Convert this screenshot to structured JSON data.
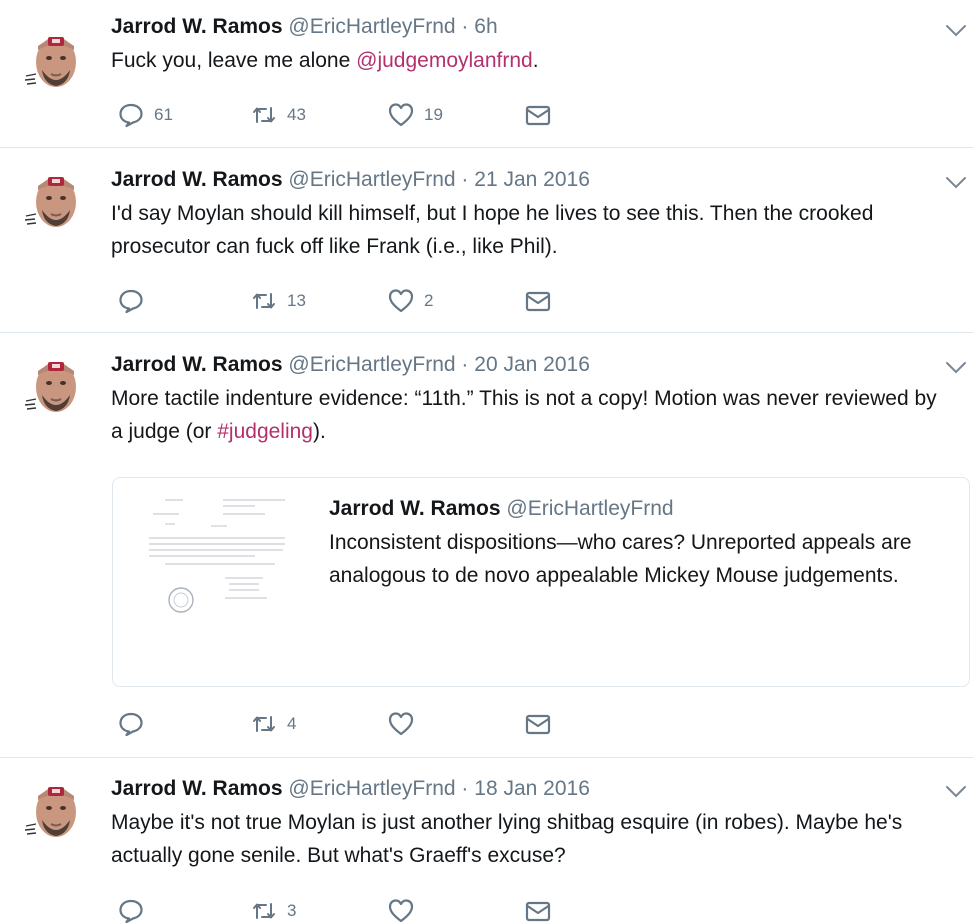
{
  "tweets": [
    {
      "name": "Jarrod W. Ramos",
      "handle": "@EricHartleyFrnd",
      "sep": " · ",
      "time": "6h",
      "text_before": "Fuck you, leave me alone ",
      "text_link": "@judgemoylanfrnd",
      "text_after": ".",
      "replies": "61",
      "retweets": "43",
      "likes": "19"
    },
    {
      "name": "Jarrod W. Ramos",
      "handle": "@EricHartleyFrnd",
      "sep": " · ",
      "time": "21 Jan 2016",
      "text_before": "I'd say Moylan should kill himself, but I hope he lives to see this. Then the crooked prosecutor can fuck off like Frank (i.e., like Phil).",
      "text_link": "",
      "text_after": "",
      "replies": "",
      "retweets": "13",
      "likes": "2"
    },
    {
      "name": "Jarrod W. Ramos",
      "handle": "@EricHartleyFrnd",
      "sep": " · ",
      "time": "20 Jan 2016",
      "text_before": "More tactile indenture evidence: “11th.” This is not a copy! Motion was never reviewed by a judge (or ",
      "text_link": "#judgeling",
      "text_after": ").",
      "replies": "",
      "retweets": "4",
      "likes": "",
      "quote": {
        "name": "Jarrod W. Ramos",
        "handle": "@EricHartleyFrnd",
        "text": "Inconsistent dispositions—who cares? Unreported appeals are analogous to de novo appealable Mickey Mouse judgements."
      }
    },
    {
      "name": "Jarrod W. Ramos",
      "handle": "@EricHartleyFrnd",
      "sep": " · ",
      "time": "18 Jan 2016",
      "text_before": "Maybe it's not true Moylan is just another lying shitbag esquire (in robes). Maybe he's actually gone senile. But what's Graeff's excuse?",
      "text_link": "",
      "text_after": "",
      "replies": "",
      "retweets": "3",
      "likes": ""
    }
  ],
  "icons": {
    "reply": "reply-icon",
    "retweet": "retweet-icon",
    "like": "heart-icon",
    "dm": "envelope-icon",
    "more": "chevron-down-icon"
  },
  "colors": {
    "link": "#b3306e",
    "muted": "#657786",
    "text": "#14171a",
    "divider": "#e1e8ed"
  }
}
